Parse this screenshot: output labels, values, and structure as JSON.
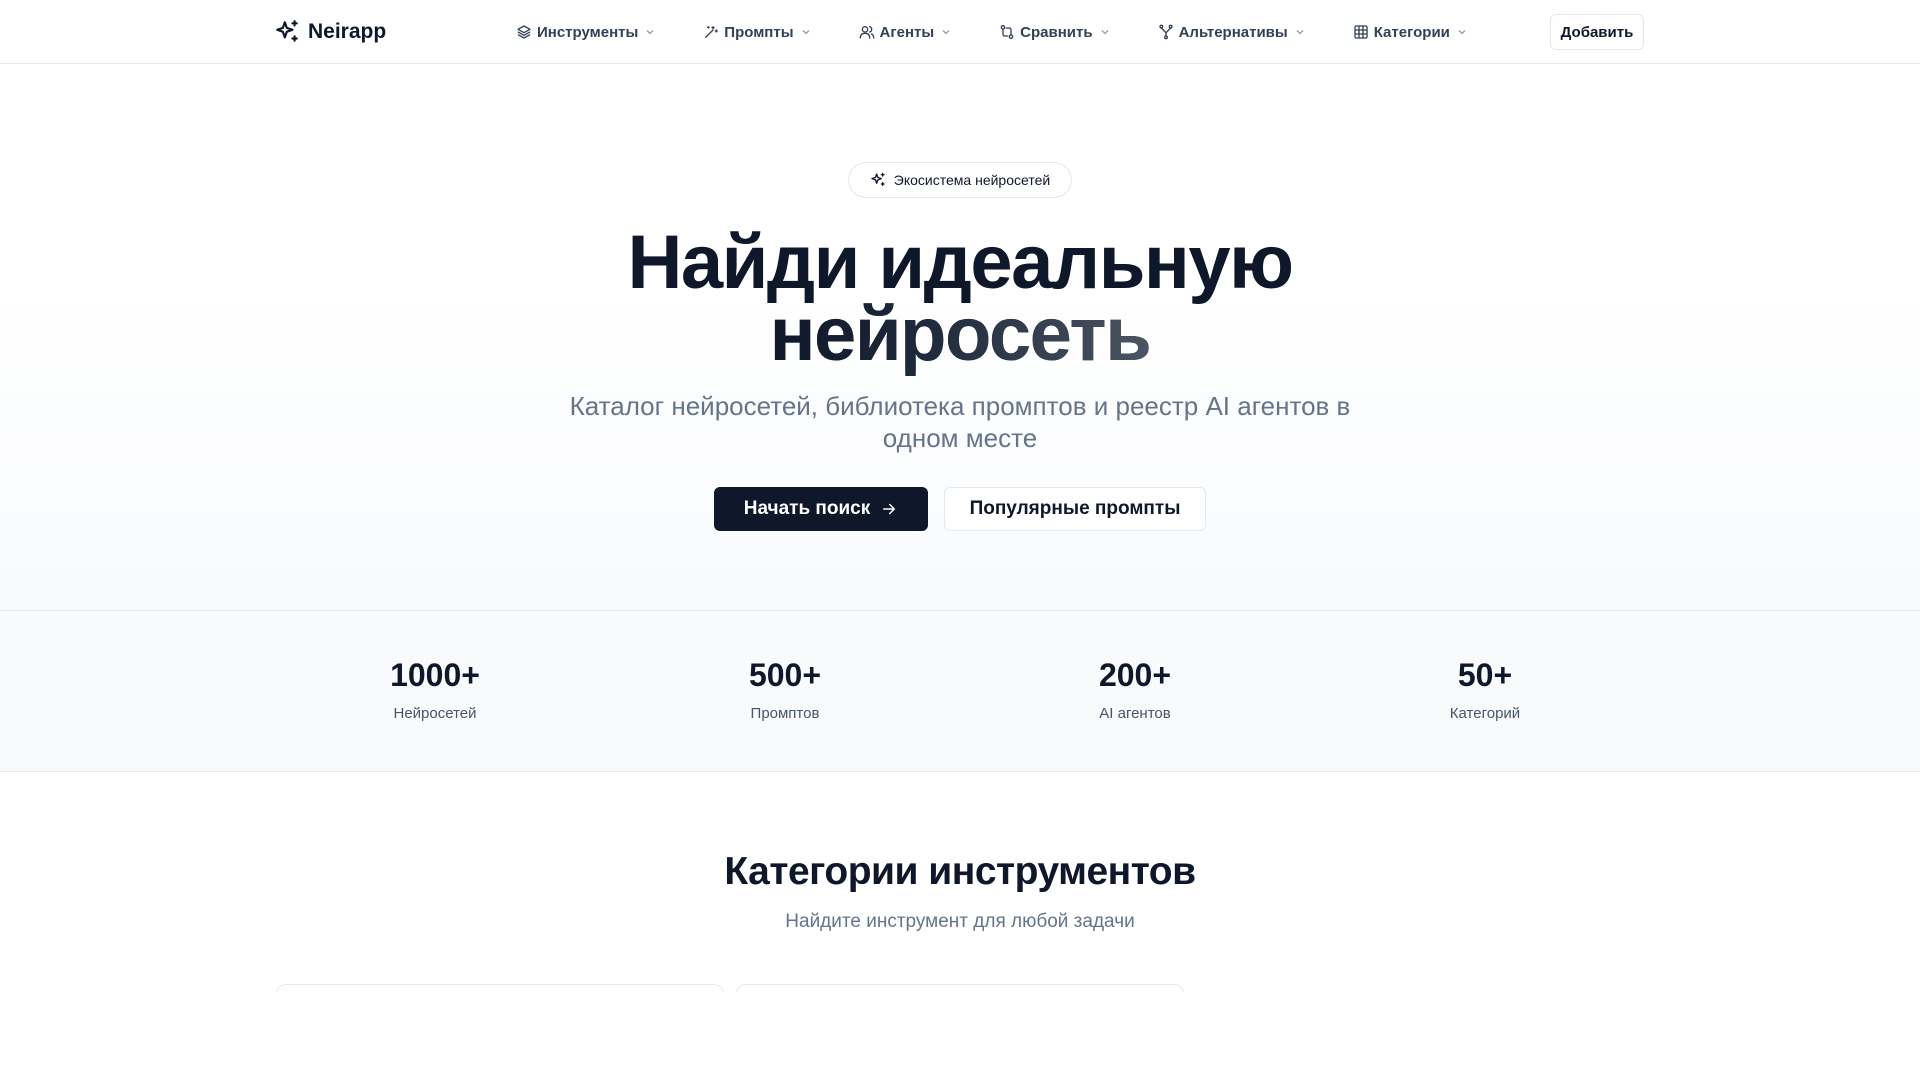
{
  "nav": {
    "logo": "Neirapp",
    "items": [
      {
        "label": "Инструменты",
        "icon": "layers-icon"
      },
      {
        "label": "Промпты",
        "icon": "wand-icon"
      },
      {
        "label": "Агенты",
        "icon": "users-icon"
      },
      {
        "label": "Сравнить",
        "icon": "compare-icon"
      },
      {
        "label": "Альтернативы",
        "icon": "split-icon"
      },
      {
        "label": "Категории",
        "icon": "grid-icon"
      }
    ],
    "add_label": "Добавить"
  },
  "hero": {
    "badge": "Экосистема нейросетей",
    "title_line1": "Найди идеальную",
    "title_line2": "нейросеть",
    "subtitle": "Каталог нейросетей, библиотека промптов и реестр AI агентов в одном месте",
    "primary_cta": "Начать поиск",
    "secondary_cta": "Популярные промпты"
  },
  "stats": [
    {
      "value": "1000+",
      "label": "Нейросетей"
    },
    {
      "value": "500+",
      "label": "Промптов"
    },
    {
      "value": "200+",
      "label": "AI агентов"
    },
    {
      "value": "50+",
      "label": "Категорий"
    }
  ],
  "categories": {
    "title": "Категории инструментов",
    "subtitle": "Найдите инструмент для любой задачи"
  },
  "colors": {
    "primary": "#0f172a",
    "muted": "#64748b",
    "border": "#e2e8f0",
    "stats_bg": "#f8fafc"
  }
}
